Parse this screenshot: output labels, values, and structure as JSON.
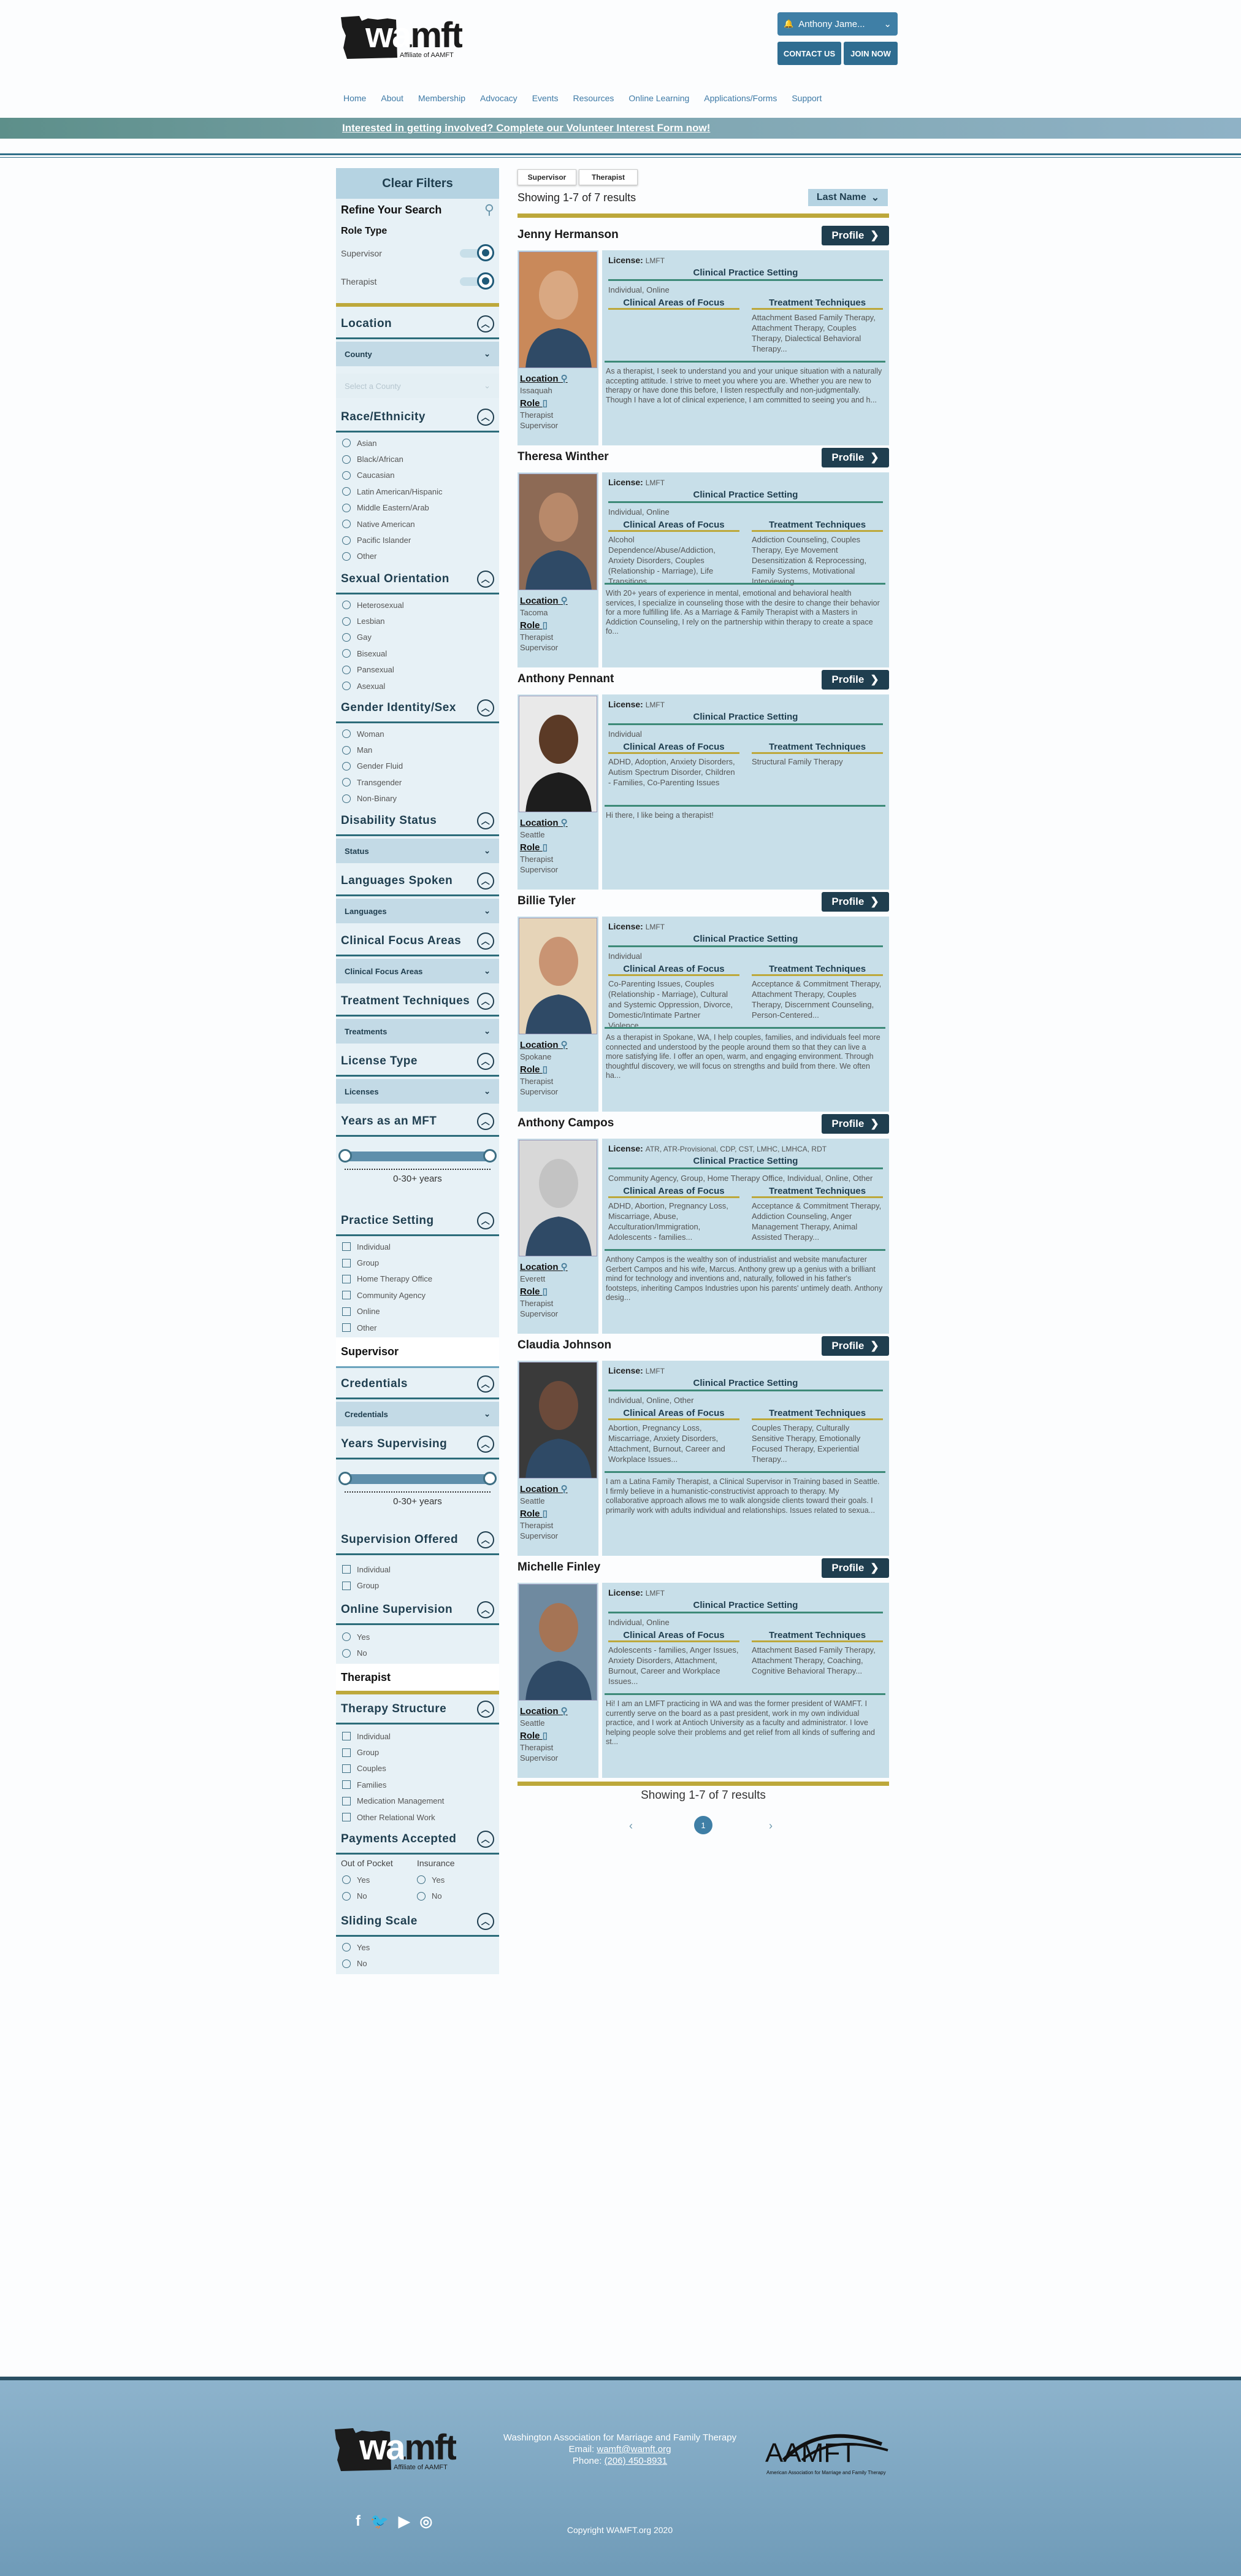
{
  "header": {
    "logo_text": "wamft",
    "logo_sub": "Affiliate of AAMFT",
    "user_name": "Anthony Jame...",
    "contact_label": "CONTACT US",
    "join_label": "JOIN NOW",
    "nav": [
      "Home",
      "About",
      "Membership",
      "Advocacy",
      "Events",
      "Resources",
      "Online Learning",
      "Applications/Forms",
      "Support"
    ],
    "banner": "Interested in getting involved? Complete our Volunteer Interest Form now!"
  },
  "filters": {
    "clear": "Clear Filters",
    "refine": "Refine Your Search",
    "role_type": "Role Type",
    "roles": [
      "Supervisor",
      "Therapist"
    ],
    "location": "Location",
    "county": "County",
    "county_placeholder": "Select a County",
    "race": "Race/Ethnicity",
    "race_opts": [
      "Asian",
      "Black/African",
      "Caucasian",
      "Latin American/Hispanic",
      "Middle Eastern/Arab",
      "Native American",
      "Pacific Islander",
      "Other"
    ],
    "orientation": "Sexual Orientation",
    "orientation_opts": [
      "Heterosexual",
      "Lesbian",
      "Gay",
      "Bisexual",
      "Pansexual",
      "Asexual"
    ],
    "gender": "Gender Identity/Sex",
    "gender_opts": [
      "Woman",
      "Man",
      "Gender Fluid",
      "Transgender",
      "Non-Binary"
    ],
    "disability": "Disability Status",
    "status": "Status",
    "languages": "Languages Spoken",
    "languages_sel": "Languages",
    "focus": "Clinical Focus Areas",
    "focus_sel": "Clinical Focus Areas",
    "techniques": "Treatment Techniques",
    "treatments": "Treatments",
    "license": "License Type",
    "licenses": "Licenses",
    "years": "Years as an MFT",
    "years_range": "0-30+ years",
    "practice": "Practice Setting",
    "practice_opts": [
      "Individual",
      "Group",
      "Home Therapy Office",
      "Community Agency",
      "Online",
      "Other"
    ],
    "supervisor_title": "Supervisor",
    "credentials": "Credentials",
    "credentials_sel": "Credentials",
    "years_sup": "Years Supervising",
    "years_sup_range": "0-30+ years",
    "sup_offered": "Supervision Offered",
    "sup_offered_opts": [
      "Individual",
      "Group"
    ],
    "online_sup": "Online Supervision",
    "yes_no": [
      "Yes",
      "No"
    ],
    "therapist_title": "Therapist",
    "structure": "Therapy Structure",
    "structure_opts": [
      "Individual",
      "Group",
      "Couples",
      "Families",
      "Medication Management",
      "Other Relational Work"
    ],
    "payments": "Payments Accepted",
    "out_of_pocket": "Out of Pocket",
    "insurance": "Insurance",
    "sliding": "Sliding Scale"
  },
  "results": {
    "tabs": [
      "Supervisor",
      "Therapist"
    ],
    "showing": "Showing 1-7 of 7 results",
    "sort": "Last Name",
    "page": "1",
    "labels": {
      "profile": "Profile",
      "license": "License:",
      "practice": "Clinical Practice Setting",
      "focus": "Clinical Areas of Focus",
      "techniques": "Treatment Techniques",
      "location": "Location",
      "role": "Role"
    },
    "people": [
      {
        "name": "Jenny Hermanson",
        "license": "LMFT",
        "setting": "Individual, Online",
        "focus": "",
        "techniques": "Attachment Based Family Therapy, Attachment Therapy, Couples Therapy, Dialectical Behavioral Therapy...",
        "bio": "As a therapist, I seek to understand you and your unique situation with a naturally accepting attitude. I strive to meet you where you are. Whether you are new to therapy or have done this before, I listen respectfully and non-judgmentally. Though I have a lot of clinical experience, I am committed to seeing you and h...",
        "city": "Issaquah",
        "roles": "Therapist\nSupervisor"
      },
      {
        "name": "Theresa Winther",
        "license": "LMFT",
        "setting": "Individual, Online",
        "focus": "Alcohol Dependence/Abuse/Addiction, Anxiety Disorders, Couples (Relationship - Marriage), Life Transitions...",
        "techniques": "Addiction Counseling, Couples Therapy, Eye Movement Desensitization & Reprocessing, Family Systems, Motivational Interviewing...",
        "bio": "With 20+ years of experience in mental, emotional and behavioral health services, I specialize in counseling those with the desire to change their behavior for a more fulfilling life. As a Marriage & Family Therapist with a Masters in Addiction Counseling, I rely on the partnership within therapy to create a space fo...",
        "city": "Tacoma",
        "roles": "Therapist\nSupervisor"
      },
      {
        "name": "Anthony Pennant",
        "license": "LMFT",
        "setting": "Individual",
        "focus": "ADHD, Adoption, Anxiety Disorders, Autism Spectrum Disorder, Children - Families, Co-Parenting Issues",
        "techniques": "Structural Family Therapy",
        "bio": "Hi there, I like being a therapist!",
        "city": "Seattle",
        "roles": "Therapist\nSupervisor"
      },
      {
        "name": "Billie Tyler",
        "license": "LMFT",
        "setting": "Individual",
        "focus": "Co-Parenting Issues, Couples (Relationship - Marriage), Cultural and Systemic Oppression, Divorce, Domestic/Intimate Partner Violence...",
        "techniques": "Acceptance & Commitment Therapy, Attachment Therapy, Couples Therapy, Discernment Counseling, Person-Centered...",
        "bio": "As a therapist in Spokane, WA, I help couples, families, and individuals feel more connected and understood by the people around them so that they can live a more satisfying life. I offer an open, warm, and engaging environment. Through thoughtful discovery, we will focus on strengths and build from there. We often ha...",
        "city": "Spokane",
        "roles": "Therapist\nSupervisor"
      },
      {
        "name": "Anthony Campos",
        "license": "ATR, ATR-Provisional, CDP, CST, LMHC, LMHCA, RDT",
        "setting": "Community Agency, Group, Home Therapy Office, Individual, Online, Other",
        "focus": "ADHD, Abortion, Pregnancy Loss, Miscarriage, Abuse, Acculturation/Immigration, Adolescents - families...",
        "techniques": "Acceptance & Commitment Therapy, Addiction Counseling, Anger Management Therapy, Animal Assisted Therapy...",
        "bio": "Anthony Campos is the wealthy son of industrialist and website manufacturer Gerbert Campos and his wife, Marcus. Anthony grew up a genius with a brilliant mind for technology and inventions and, naturally, followed in his father's footsteps, inheriting Campos Industries upon his parents' untimely death. Anthony desig...",
        "city": "Everett",
        "roles": "Therapist\nSupervisor"
      },
      {
        "name": "Claudia Johnson",
        "license": "LMFT",
        "setting": "Individual, Online, Other",
        "focus": "Abortion, Pregnancy Loss, Miscarriage, Anxiety Disorders, Attachment, Burnout, Career and Workplace Issues...",
        "techniques": "Couples Therapy, Culturally Sensitive Therapy, Emotionally Focused Therapy, Experiential Therapy...",
        "bio": "I am a Latina Family Therapist, a Clinical Supervisor in Training based in Seattle. I firmly believe in a humanistic-constructivist approach to therapy. My collaborative approach allows me to walk alongside clients toward their goals. I primarily work with adults individual and relationships. Issues related to sexua...",
        "city": "Seattle",
        "roles": "Therapist\nSupervisor"
      },
      {
        "name": "Michelle Finley",
        "license": "LMFT",
        "setting": "Individual, Online",
        "focus": "Adolescents - families, Anger Issues, Anxiety Disorders, Attachment, Burnout, Career and Workplace Issues...",
        "techniques": "Attachment Based Family Therapy, Attachment Therapy, Coaching, Cognitive Behavioral Therapy...",
        "bio": "Hi! I am an LMFT practicing in WA and was the former president of WAMFT. I currently serve on the board as a past president, work in my own individual practice, and I work at Antioch University as a faculty and administrator. I love helping people solve their problems and get relief from all kinds of suffering and st...",
        "city": "Seattle",
        "roles": "Therapist\nSupervisor"
      }
    ]
  },
  "footer": {
    "org": "Washington Association for Marriage and Family Therapy",
    "email_label": "Email:",
    "email": "wamft@wamft.org",
    "phone_label": "Phone:",
    "phone": "(206) 450-8931",
    "aamft": "AAMFT",
    "aamft_sub": "American Association for Marriage and Family Therapy",
    "copyright": "Copyright WAMFT.org 2020"
  },
  "colors": {
    "accent": "#1f3e4f",
    "panel": "#c8dfe9",
    "teal_line": "#3d8a78",
    "gold_line": "#bda83b",
    "footer": "#7fa6bf"
  }
}
